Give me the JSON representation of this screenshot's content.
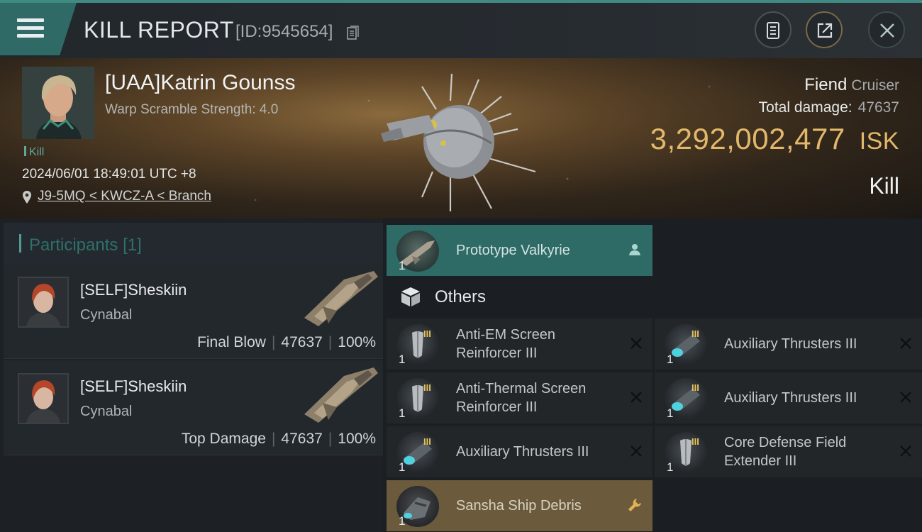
{
  "header": {
    "title": "KILL REPORT",
    "kill_id": "[ID:9545654]"
  },
  "victim": {
    "name": "[UAA]Katrin Gounss",
    "subtitle": "Warp Scramble Strength: 4.0",
    "tag": "Kill",
    "datetime": "2024/06/01 18:49:01 UTC +8",
    "location": "J9-5MQ < KWCZ-A < Branch",
    "ship": "Fiend",
    "ship_class": "Cruiser",
    "damage_label": "Total damage:",
    "damage_value": "47637",
    "isk_value": "3,292,002,477",
    "isk_unit": "ISK",
    "result": "Kill"
  },
  "participants": {
    "title": "Participants",
    "count": "[1]",
    "rows": [
      {
        "name": "[SELF]Sheskiin",
        "ship": "Cynabal",
        "role": "Final Blow",
        "damage": "47637",
        "percent": "100%"
      },
      {
        "name": "[SELF]Sheskiin",
        "ship": "Cynabal",
        "role": "Top Damage",
        "damage": "47637",
        "percent": "100%"
      }
    ]
  },
  "items": {
    "drone": {
      "qty": "1",
      "label": "Prototype  Valkyrie"
    },
    "others_label": "Others",
    "left": [
      {
        "qty": "1",
        "label": "Anti-EM Screen Reinforcer III",
        "icon": "shield-module-icon"
      },
      {
        "qty": "1",
        "label": "Anti-Thermal Screen Reinforcer III",
        "icon": "shield-module-icon"
      },
      {
        "qty": "1",
        "label": "Auxiliary Thrusters III",
        "icon": "thruster-icon"
      },
      {
        "qty": "1",
        "label": "Sansha Ship Debris",
        "icon": "debris-icon"
      }
    ],
    "right": [
      {
        "qty": "1",
        "label": "Auxiliary Thrusters III",
        "icon": "thruster-icon"
      },
      {
        "qty": "1",
        "label": "Auxiliary Thrusters III",
        "icon": "thruster-icon"
      },
      {
        "qty": "1",
        "label": "Core Defense Field Extender III",
        "icon": "shield-module-icon"
      }
    ],
    "rank_mark": "III"
  },
  "colors": {
    "accent": "#2f6a66",
    "isk": "#e2b86a",
    "debris": "#6b5b3c"
  }
}
